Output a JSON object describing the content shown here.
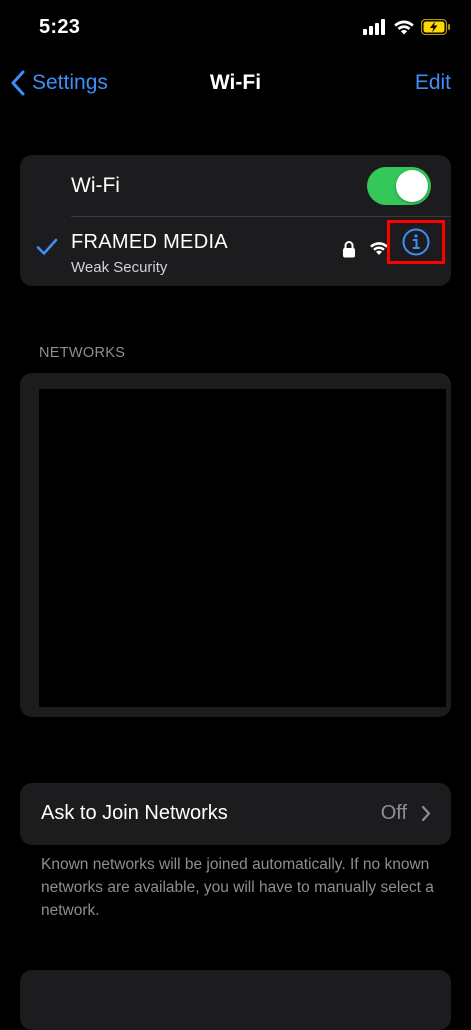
{
  "status_bar": {
    "time": "5:23"
  },
  "nav": {
    "back_label": "Settings",
    "title": "Wi-Fi",
    "edit_label": "Edit"
  },
  "wifi_card": {
    "toggle_label": "Wi-Fi",
    "toggle_on": true,
    "connected_network": {
      "name": "FRAMED MEDIA",
      "security_note": "Weak Security"
    }
  },
  "networks_section": {
    "header": "NETWORKS"
  },
  "ask_to_join": {
    "label": "Ask to Join Networks",
    "value": "Off",
    "footnote": "Known networks will be joined automatically. If no known networks are available, you will have to manually select a network."
  },
  "colors": {
    "accent": "#3d8ef7",
    "toggle_on": "#34c759",
    "card_bg": "#1c1c1e",
    "highlight": "#ff0000",
    "battery": "#ffd60a"
  },
  "icons": {
    "back": "chevron-left-icon",
    "check": "checkmark-icon",
    "lock": "lock-icon",
    "wifi": "wifi-icon",
    "info": "info-circle-icon",
    "chevron": "chevron-right-icon"
  }
}
